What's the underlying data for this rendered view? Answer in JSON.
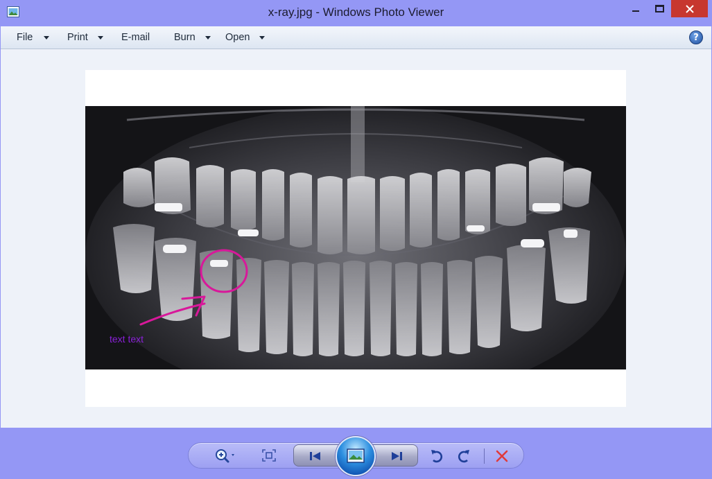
{
  "window": {
    "title": "x-ray.jpg - Windows Photo Viewer"
  },
  "menu": {
    "items": [
      {
        "label": "File",
        "has_dropdown": true
      },
      {
        "label": "Print",
        "has_dropdown": true
      },
      {
        "label": "E-mail",
        "has_dropdown": false
      },
      {
        "label": "Burn",
        "has_dropdown": true
      },
      {
        "label": "Open",
        "has_dropdown": true
      }
    ],
    "help_label": "?"
  },
  "image": {
    "annotation_text": "text text",
    "annotation_color": "#8a20d8",
    "marker_color": "#d8189a"
  },
  "toolbar": {
    "icons": [
      "zoom-icon",
      "actual-size-icon",
      "previous-icon",
      "slideshow-icon",
      "next-icon",
      "rotate-counterclockwise-icon",
      "rotate-clockwise-icon",
      "delete-icon"
    ]
  },
  "colors": {
    "chrome": "#9497f5",
    "close_button": "#c7372f",
    "delete": "#e03a3a"
  }
}
